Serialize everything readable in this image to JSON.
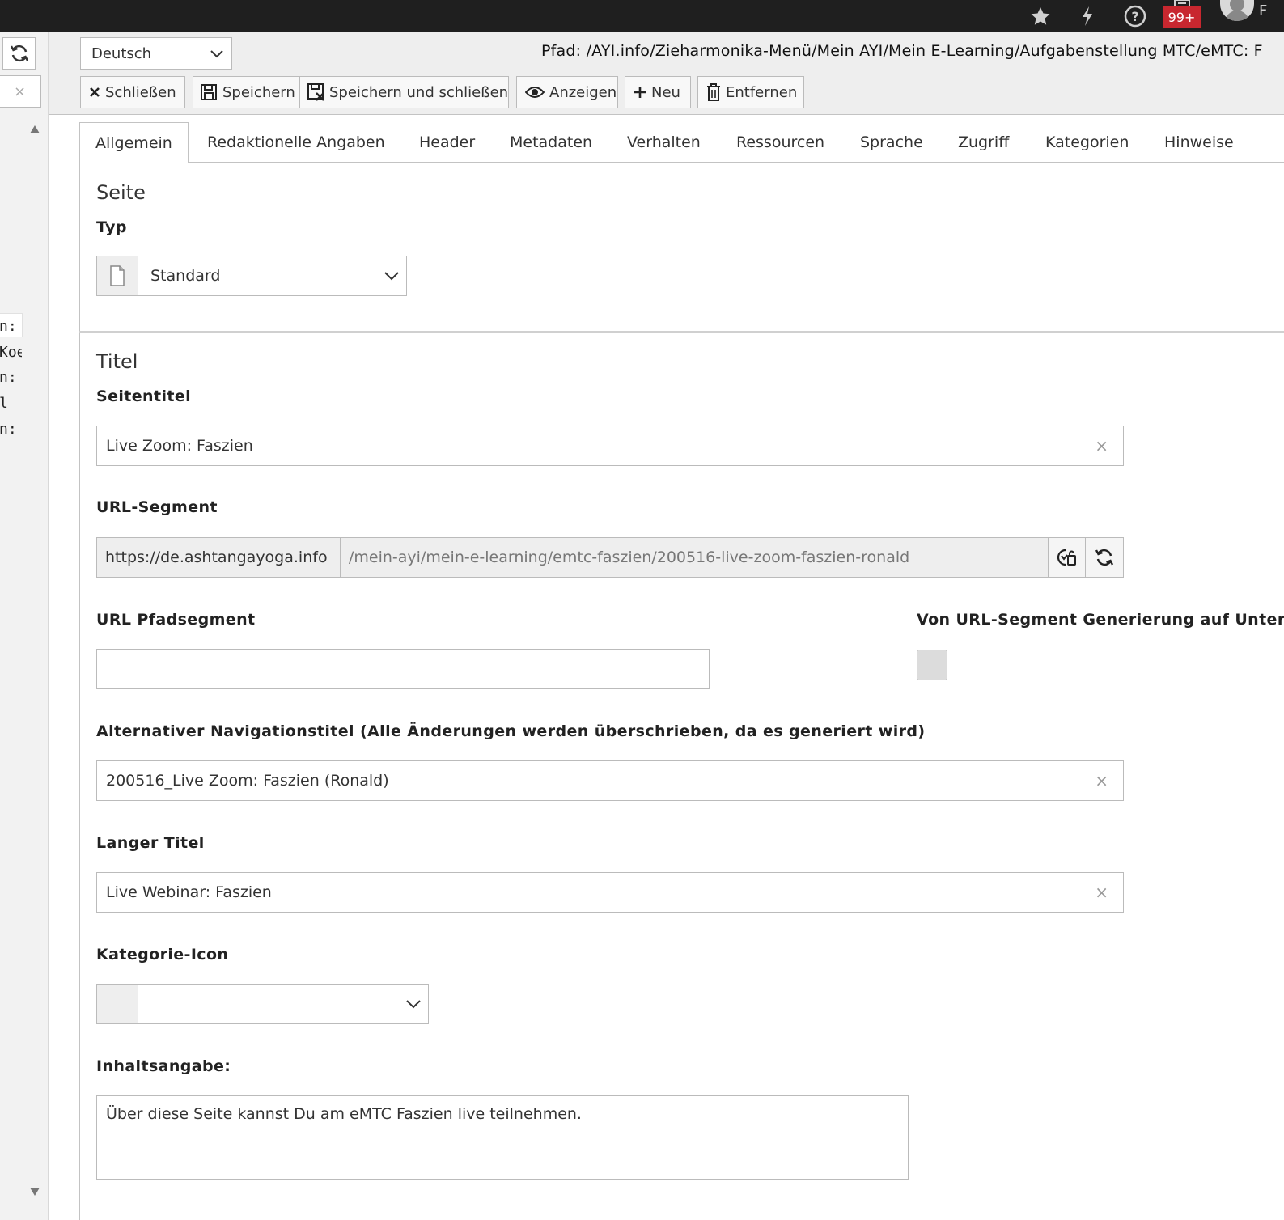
{
  "topbar": {
    "icons": [
      "star-icon",
      "bolt-icon",
      "help-icon",
      "notifications-icon",
      "user-avatar"
    ],
    "badge": "99+",
    "user_initial": "F"
  },
  "tree": {
    "filter_clear": "×",
    "items": [
      "n: F",
      "Koe",
      "n: F",
      "l",
      "n: A"
    ]
  },
  "docheader": {
    "language": "Deutsch",
    "path_label": "Pfad:",
    "path_value": "/AYI.info/Zieharmonika-Menü/Mein AYI/Mein E-Learning/Aufgabenstellung MTC/eMTC: F",
    "buttons": {
      "close": "Schließen",
      "save": "Speichern",
      "save_close": "Speichern und schließen",
      "view": "Anzeigen",
      "new": "Neu",
      "delete": "Entfernen"
    }
  },
  "tabs": [
    "Allgemein",
    "Redaktionelle Angaben",
    "Header",
    "Metadaten",
    "Verhalten",
    "Ressourcen",
    "Sprache",
    "Zugriff",
    "Kategorien",
    "Hinweise"
  ],
  "page_section": {
    "title": "Seite",
    "type_label": "Typ",
    "type_value": "Standard"
  },
  "title_section": {
    "title": "Titel",
    "page_title_label": "Seitentitel",
    "page_title_value": "Live Zoom: Faszien",
    "url_segment_label": "URL-Segment",
    "url_prefix": "https://de.ashtangayoga.info",
    "url_value": "/mein-ayi/mein-e-learning/emtc-faszien/200516-live-zoom-faszien-ronald",
    "url_path_label": "URL Pfadsegment",
    "url_path_value": "",
    "exclude_label": "Von URL-Segment Generierung auf Unter",
    "nav_title_label": "Alternativer Navigationstitel (Alle Änderungen werden überschrieben, da es generiert wird)",
    "nav_title_value": "200516_Live Zoom: Faszien (Ronald)",
    "long_title_label": "Langer Titel",
    "long_title_value": "Live Webinar: Faszien",
    "category_icon_label": "Kategorie-Icon",
    "category_icon_value": "",
    "abstract_label": "Inhaltsangabe:",
    "abstract_value": "Über diese Seite kannst Du am eMTC Faszien live teilnehmen."
  },
  "clear_symbol": "×"
}
